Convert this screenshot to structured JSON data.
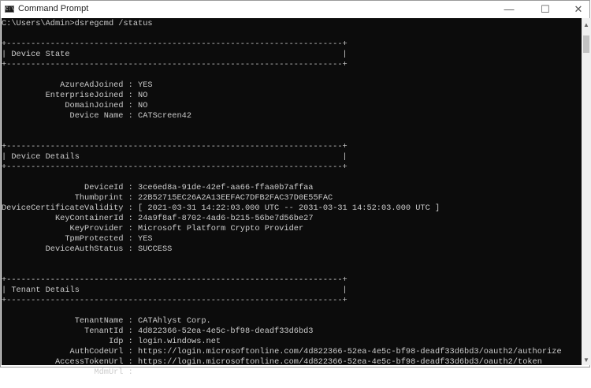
{
  "window": {
    "title": "Command Prompt",
    "icon": "cmd-icon",
    "minimize": "—",
    "maximize": "☐",
    "close": "✕"
  },
  "console": {
    "prompt": "C:\\Users\\Admin>dsregcmd /status",
    "sections": [
      {
        "title": "Device State",
        "fields": [
          {
            "name": "AzureAdJoined",
            "value": "YES"
          },
          {
            "name": "EnterpriseJoined",
            "value": "NO"
          },
          {
            "name": "DomainJoined",
            "value": "NO"
          },
          {
            "name": "Device Name",
            "value": "CATScreen42"
          }
        ]
      },
      {
        "title": "Device Details",
        "fields": [
          {
            "name": "DeviceId",
            "value": "3ce6ed8a-91de-42ef-aa66-ffaa0b7affaa"
          },
          {
            "name": "Thumbprint",
            "value": "22B52715EC26A2A13EEFAC7DFB2FAC37D0E55FAC"
          },
          {
            "name": "DeviceCertificateValidity",
            "value": "[ 2021-03-31 14:22:03.000 UTC -- 2031-03-31 14:52:03.000 UTC ]"
          },
          {
            "name": "KeyContainerId",
            "value": "24a9f8af-8702-4ad6-b215-56be7d56be27"
          },
          {
            "name": "KeyProvider",
            "value": "Microsoft Platform Crypto Provider"
          },
          {
            "name": "TpmProtected",
            "value": "YES"
          },
          {
            "name": "DeviceAuthStatus",
            "value": "SUCCESS"
          }
        ]
      },
      {
        "title": "Tenant Details",
        "fields": [
          {
            "name": "TenantName",
            "value": "CATAhlyst Corp."
          },
          {
            "name": "TenantId",
            "value": "4d822366-52ea-4e5c-bf98-deadf33d6bd3"
          },
          {
            "name": "Idp",
            "value": "login.windows.net"
          },
          {
            "name": "AuthCodeUrl",
            "value": "https://login.microsoftonline.com/4d822366-52ea-4e5c-bf98-deadf33d6bd3/oauth2/authorize"
          },
          {
            "name": "AccessTokenUrl",
            "value": "https://login.microsoftonline.com/4d822366-52ea-4e5c-bf98-deadf33d6bd3/oauth2/token"
          },
          {
            "name": "MdmUrl",
            "value": ""
          }
        ]
      }
    ]
  }
}
